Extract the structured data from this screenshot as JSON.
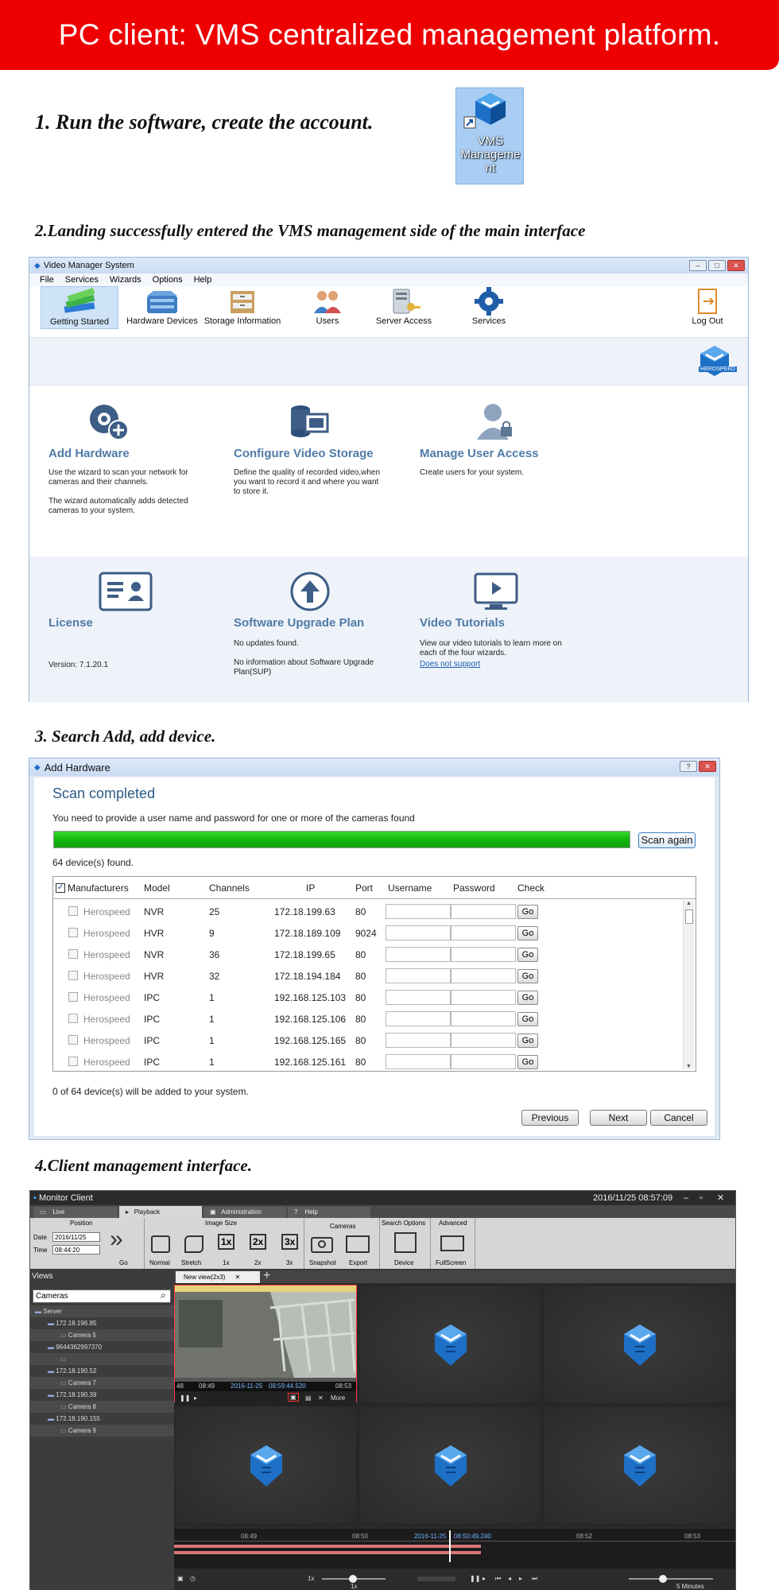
{
  "banner": "PC client: VMS centralized management platform.",
  "steps": {
    "s1": "1.  Run the software, create the account.",
    "s2": "2.Landing successfully entered the VMS management side of the main interface",
    "s3": "3.  Search Add, add device.",
    "s4": "4.Client management interface."
  },
  "desktop_icon": {
    "line1": "VMS",
    "line2": "Manageme",
    "line3": "nt"
  },
  "vms": {
    "title": "Video Manager System",
    "menu": [
      "File",
      "Services",
      "Wizards",
      "Options",
      "Help"
    ],
    "toolbar": [
      "Getting Started",
      "Hardware Devices",
      "Storage Information",
      "Users",
      "Server Access",
      "Services",
      "Log Out"
    ],
    "logo_text": "HEROSPEED",
    "cards": {
      "add_hw": {
        "title": "Add Hardware",
        "d1": "Use the wizard to scan your network for cameras and their channels.",
        "d2": "The wizard automatically adds detected cameras to your system."
      },
      "storage": {
        "title": "Configure Video Storage",
        "d1": "Define the quality of recorded video,when you want to record it and where you want to store it."
      },
      "access": {
        "title": "Manage User Access",
        "d1": "Create users for your system."
      },
      "license": {
        "title": "License",
        "d1": "Version: 7.1.20.1"
      },
      "upgrade": {
        "title": "Software Upgrade Plan",
        "d1": "No updates found.",
        "d2": "No information about Software Upgrade Plan(SUP)"
      },
      "tutorials": {
        "title": "Video Tutorials",
        "d1": "View our video tutorials to learn more on each of the four wizards.",
        "link": "Does not support"
      }
    }
  },
  "add_hw": {
    "title": "Add Hardware",
    "heading": "Scan completed",
    "subtitle": "You need to provide a user name and password for one or more of the cameras found",
    "progress": 1.0,
    "scan_again": "Scan again",
    "found": "64 device(s) found.",
    "columns": [
      "Manufacturers",
      "Model",
      "Channels",
      "IP",
      "Port",
      "Username",
      "Password",
      "Check"
    ],
    "rows": [
      [
        "Herospeed",
        "NVR",
        "25",
        "172.18.199.63",
        "80"
      ],
      [
        "Herospeed",
        "HVR",
        "9",
        "172.18.189.109",
        "9024"
      ],
      [
        "Herospeed",
        "NVR",
        "36",
        "172.18.199.65",
        "80"
      ],
      [
        "Herospeed",
        "HVR",
        "32",
        "172.18.194.184",
        "80"
      ],
      [
        "Herospeed",
        "IPC",
        "1",
        "192.168.125.103",
        "80"
      ],
      [
        "Herospeed",
        "IPC",
        "1",
        "192.168.125.106",
        "80"
      ],
      [
        "Herospeed",
        "IPC",
        "1",
        "192.168.125.165",
        "80"
      ],
      [
        "Herospeed",
        "IPC",
        "1",
        "192.168.125.161",
        "80"
      ]
    ],
    "go": "Go",
    "footer": "0 of 64 device(s) will be added to your system.",
    "buttons": [
      "Previous",
      "Next",
      "Cancel"
    ]
  },
  "monitor": {
    "title": "Monitor Client",
    "datetime": "2016/11/25 08:57:09",
    "tabs": [
      "Live",
      "Playback",
      "Administration",
      "Help"
    ],
    "groups": [
      "Position",
      "Image Size",
      "Cameras",
      "Search Options",
      "Advanced"
    ],
    "date_label": "Date",
    "date_value": "2016/11/25",
    "time_label": "Time",
    "time_value": "08:44:20",
    "go": "Go",
    "tools": [
      "Normal",
      "Stretch",
      "1x",
      "2x",
      "3x",
      "Snapshot",
      "Export",
      "Device",
      "FullScreen"
    ],
    "views": "Views",
    "view_tab": "New view(2x3)",
    "search": "Cameras",
    "tree": [
      "Server",
      "172.18.196.85",
      "Camera 5",
      "9644362997370",
      "172.18.190.52",
      "Camera 7",
      "172.18.190.39",
      "Camera 8",
      "172.18.190.155",
      "Camera 9"
    ],
    "cam_ticks": [
      "48",
      "08:49",
      "2016-11-25",
      "08:59:44.520",
      "08:53"
    ],
    "more": "More",
    "timeline_ticks": [
      "08:49",
      "08:50",
      "2016-11-25",
      "08:50:49.240",
      "08:52",
      "08:53"
    ],
    "speed": "1x",
    "speed_sub": "1x",
    "range": "5 Minutes"
  }
}
